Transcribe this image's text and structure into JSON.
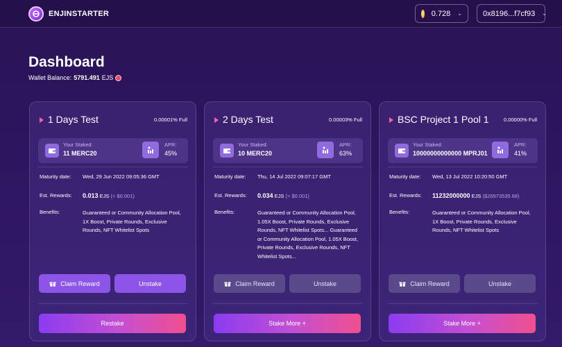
{
  "header": {
    "brand": "ENJINSTARTER",
    "balance_pill": "0.728",
    "address_pill": "0x8196...f7cf93"
  },
  "dashboard": {
    "title": "Dashboard",
    "wallet_label": "Wallet Balance:",
    "wallet_value": "5791.491",
    "wallet_unit": "EJS"
  },
  "cards": [
    {
      "name": "1 Days Test",
      "full": "0.00001% Full",
      "staked_label": "Your Staked:",
      "staked_value": "11 MERC20",
      "apr_label": "APR:",
      "apr_value": "45%",
      "maturity_label": "Maturity date:",
      "maturity_value": "Wed, 29 Jun 2022 09:05:36 GMT",
      "rewards_label": "Est. Rewards:",
      "rewards_value": "0.013",
      "rewards_unit": "EJS",
      "rewards_usd": "(< $0.001)",
      "benefits_label": "Benefits:",
      "benefits": "Guaranteed or Community Allocation Pool, 1X Boost, Private Rounds, Exclusive Rounds, NFT Whitelist Spots",
      "claim_label": "Claim Reward",
      "unstake_label": "Unstake",
      "wide_label": "Restake"
    },
    {
      "name": "2 Days Test",
      "full": "0.00003% Full",
      "staked_label": "Your Staked:",
      "staked_value": "10 MERC20",
      "apr_label": "APR:",
      "apr_value": "63%",
      "maturity_label": "Maturity date:",
      "maturity_value": "Thu, 14 Jul 2022 09:07:17 GMT",
      "rewards_label": "Est. Rewards:",
      "rewards_value": "0.034",
      "rewards_unit": "EJS",
      "rewards_usd": "(< $0.001)",
      "benefits_label": "Benefits:",
      "benefits": "Guaranteed or Community Allocation Pool, 1.05X Boost, Private Rounds, Exclusive Rounds, NFT Whitelist Spots... Guaranteed or Community Allocation Pool, 1.05X Boost, Private Rounds, Exclusive Rounds, NFT Whitelist Spots...",
      "claim_label": "Claim Reward",
      "unstake_label": "Unstake",
      "wide_label": "Stake More +"
    },
    {
      "name": "BSC Project 1 Pool 1",
      "full": "0.00000% Full",
      "staked_label": "Your Staked:",
      "staked_value": "10000000000000 MPRJ01",
      "apr_label": "APR:",
      "apr_value": "41%",
      "maturity_label": "Maturity date:",
      "maturity_value": "Wed, 13 Jul 2022 10:20:50 GMT",
      "rewards_label": "Est. Rewards:",
      "rewards_value": "11232000000",
      "rewards_unit": "EJS",
      "rewards_usd": "($26973535.68)",
      "benefits_label": "Benefits:",
      "benefits": "Guaranteed or Community Allocation Pool, 1X Boost, Private Rounds, Exclusive Rounds, NFT Whitelist Spots",
      "claim_label": "Claim Reward",
      "unstake_label": "Unstake",
      "wide_label": "Stake More +"
    }
  ],
  "colors": {
    "accent_purple": "#8c55e8",
    "gradient_start": "#8a3cf0",
    "gradient_end": "#f04f8e",
    "triangle": "#ff5fb0"
  },
  "icons": [
    "enjinstarter-logo-icon",
    "coin-icon",
    "chevron-down-icon",
    "ejs-token-icon",
    "wallet-icon",
    "apr-chart-icon",
    "gift-icon"
  ]
}
